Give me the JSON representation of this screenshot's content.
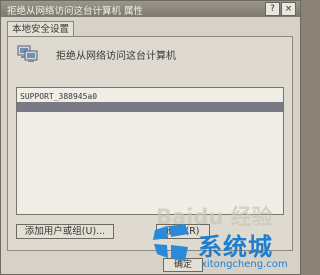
{
  "window": {
    "title": "拒绝从网络访问这台计算机 属性",
    "help_icon": "?",
    "close_icon": "×"
  },
  "tab": {
    "label": "本地安全设置"
  },
  "policy": {
    "label": "拒绝从网络访问这台计算机",
    "icon": "policy-computers-icon"
  },
  "list": {
    "items": [
      {
        "label": "SUPPORT_388945a0",
        "selected": false
      },
      {
        "label": "",
        "selected": true
      }
    ]
  },
  "buttons": {
    "add_user_or_group": "添加用户或组(U)...",
    "remove": "删除(R)",
    "ok": "确定"
  },
  "watermark": {
    "text": "Baidu 经验"
  },
  "branding": {
    "logo_text": "系统城",
    "url": "xitongcheng.com",
    "color": "#1d7fd0"
  }
}
